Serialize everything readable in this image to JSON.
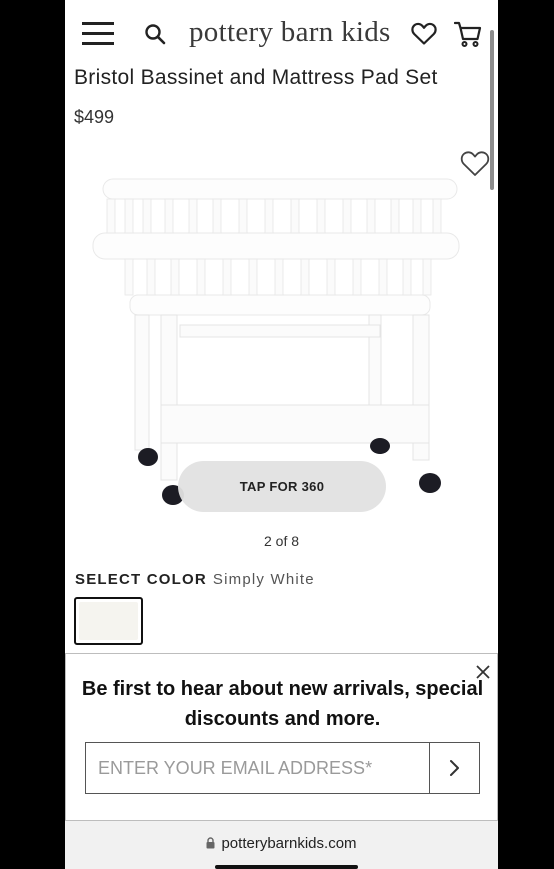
{
  "header": {
    "brand": "pottery barn kids",
    "icons": [
      "menu-icon",
      "search-icon",
      "heart-icon",
      "cart-icon"
    ]
  },
  "product": {
    "title": "Bristol Bassinet and Mattress Pad Set",
    "price": "$499",
    "tap_360_label": "TAP FOR 360",
    "image_counter": "2 of 8",
    "select_color_label": "SELECT COLOR",
    "selected_color": "Simply White"
  },
  "popup": {
    "message": "Be first to hear about new arrivals, special discounts and more.",
    "email_placeholder": "ENTER YOUR EMAIL ADDRESS*",
    "email_value": ""
  },
  "browser": {
    "url": "potterybarnkids.com"
  },
  "colors": {
    "swatch": "#f5f4ef",
    "popup_border": "#bdbdbd"
  }
}
